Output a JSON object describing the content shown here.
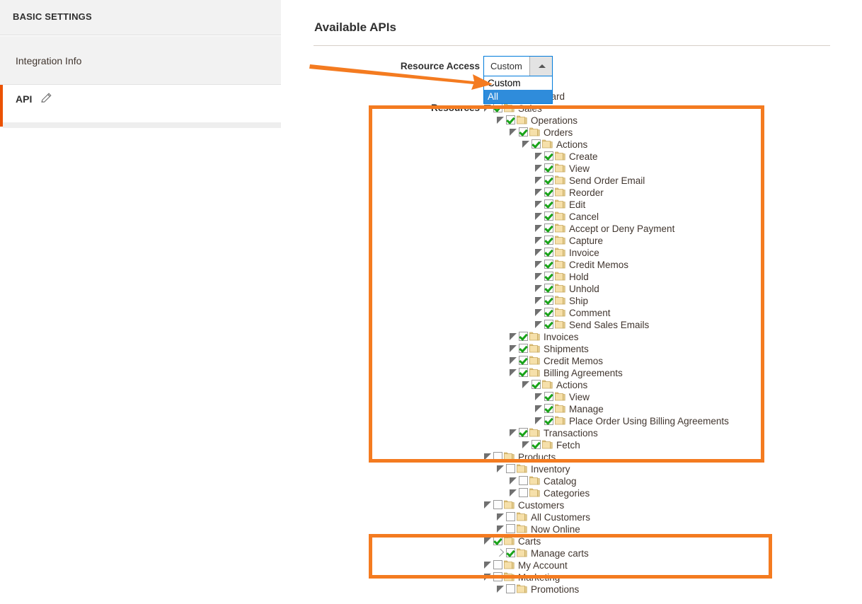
{
  "sidebar": {
    "header": "BASIC SETTINGS",
    "items": [
      {
        "label": "Integration Info",
        "active": false
      },
      {
        "label": "API",
        "active": true,
        "icon": "pencil-icon"
      }
    ]
  },
  "main": {
    "title": "Available APIs",
    "fields": {
      "resource_access_label": "Resource Access",
      "resources_label": "Resources"
    },
    "select": {
      "name": "resource-access-select",
      "value": "Custom",
      "expanded": true,
      "caret_icon": "chevron-up-icon",
      "options": [
        {
          "label": "Custom",
          "selected": false
        },
        {
          "label": "All",
          "selected": true
        }
      ]
    }
  },
  "tree": {
    "nodes": [
      {
        "label": "Dashboard",
        "depth": 0,
        "checked": false,
        "arrow": "open"
      },
      {
        "label": "Sales",
        "depth": 0,
        "checked": true,
        "arrow": "open"
      },
      {
        "label": "Operations",
        "depth": 1,
        "checked": true,
        "arrow": "open"
      },
      {
        "label": "Orders",
        "depth": 2,
        "checked": true,
        "arrow": "open"
      },
      {
        "label": "Actions",
        "depth": 3,
        "checked": true,
        "arrow": "open"
      },
      {
        "label": "Create",
        "depth": 4,
        "checked": true,
        "arrow": "open"
      },
      {
        "label": "View",
        "depth": 4,
        "checked": true,
        "arrow": "open"
      },
      {
        "label": "Send Order Email",
        "depth": 4,
        "checked": true,
        "arrow": "open"
      },
      {
        "label": "Reorder",
        "depth": 4,
        "checked": true,
        "arrow": "open"
      },
      {
        "label": "Edit",
        "depth": 4,
        "checked": true,
        "arrow": "open"
      },
      {
        "label": "Cancel",
        "depth": 4,
        "checked": true,
        "arrow": "open"
      },
      {
        "label": "Accept or Deny Payment",
        "depth": 4,
        "checked": true,
        "arrow": "open"
      },
      {
        "label": "Capture",
        "depth": 4,
        "checked": true,
        "arrow": "open"
      },
      {
        "label": "Invoice",
        "depth": 4,
        "checked": true,
        "arrow": "open"
      },
      {
        "label": "Credit Memos",
        "depth": 4,
        "checked": true,
        "arrow": "open"
      },
      {
        "label": "Hold",
        "depth": 4,
        "checked": true,
        "arrow": "open"
      },
      {
        "label": "Unhold",
        "depth": 4,
        "checked": true,
        "arrow": "open"
      },
      {
        "label": "Ship",
        "depth": 4,
        "checked": true,
        "arrow": "open"
      },
      {
        "label": "Comment",
        "depth": 4,
        "checked": true,
        "arrow": "open"
      },
      {
        "label": "Send Sales Emails",
        "depth": 4,
        "checked": true,
        "arrow": "open"
      },
      {
        "label": "Invoices",
        "depth": 2,
        "checked": true,
        "arrow": "open"
      },
      {
        "label": "Shipments",
        "depth": 2,
        "checked": true,
        "arrow": "open"
      },
      {
        "label": "Credit Memos",
        "depth": 2,
        "checked": true,
        "arrow": "open"
      },
      {
        "label": "Billing Agreements",
        "depth": 2,
        "checked": true,
        "arrow": "open"
      },
      {
        "label": "Actions",
        "depth": 3,
        "checked": true,
        "arrow": "open"
      },
      {
        "label": "View",
        "depth": 4,
        "checked": true,
        "arrow": "open"
      },
      {
        "label": "Manage",
        "depth": 4,
        "checked": true,
        "arrow": "open"
      },
      {
        "label": "Place Order Using Billing Agreements",
        "depth": 4,
        "checked": true,
        "arrow": "open"
      },
      {
        "label": "Transactions",
        "depth": 2,
        "checked": true,
        "arrow": "open"
      },
      {
        "label": "Fetch",
        "depth": 3,
        "checked": true,
        "arrow": "open"
      },
      {
        "label": "Products",
        "depth": 0,
        "checked": false,
        "arrow": "open"
      },
      {
        "label": "Inventory",
        "depth": 1,
        "checked": false,
        "arrow": "open"
      },
      {
        "label": "Catalog",
        "depth": 2,
        "checked": false,
        "arrow": "open"
      },
      {
        "label": "Categories",
        "depth": 2,
        "checked": false,
        "arrow": "open"
      },
      {
        "label": "Customers",
        "depth": 0,
        "checked": false,
        "arrow": "open"
      },
      {
        "label": "All Customers",
        "depth": 1,
        "checked": false,
        "arrow": "open"
      },
      {
        "label": "Now Online",
        "depth": 1,
        "checked": false,
        "arrow": "open"
      },
      {
        "label": "Carts",
        "depth": 0,
        "checked": true,
        "arrow": "open"
      },
      {
        "label": "Manage carts",
        "depth": 1,
        "checked": true,
        "arrow": "closed"
      },
      {
        "label": "My Account",
        "depth": 0,
        "checked": false,
        "arrow": "open"
      },
      {
        "label": "Marketing",
        "depth": 0,
        "checked": false,
        "arrow": "open"
      },
      {
        "label": "Promotions",
        "depth": 1,
        "checked": false,
        "arrow": "open"
      }
    ]
  },
  "annotations": {
    "color": "#f47b20",
    "arrow": {
      "name": "pointer-arrow",
      "points_to": "resource-access-select-option-custom"
    },
    "rectangles": [
      {
        "name": "sales-section-highlight"
      },
      {
        "name": "carts-section-highlight"
      }
    ]
  }
}
